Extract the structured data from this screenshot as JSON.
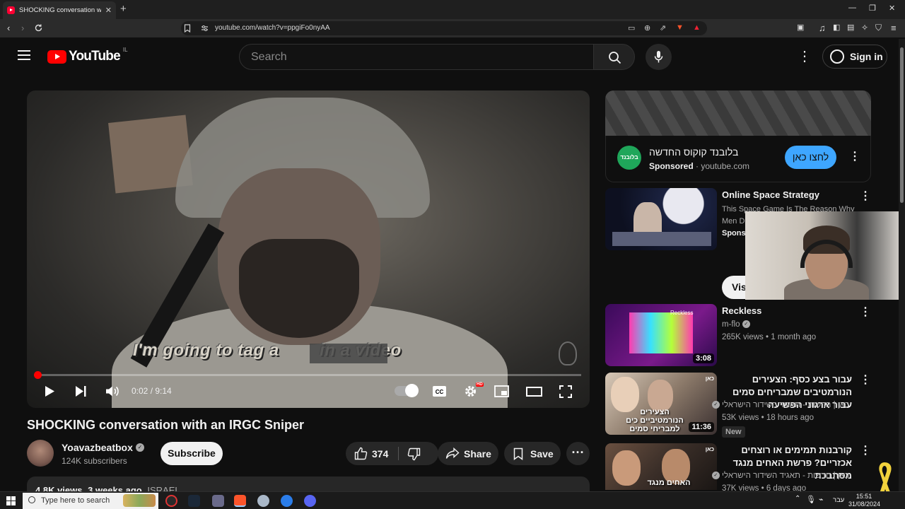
{
  "browser": {
    "tab_title": "SHOCKING conversation with an IRGC Sniper",
    "tab_close": "✕",
    "new_tab": "+",
    "url": "youtube.com/watch?v=ppgiFo0nyAA",
    "window_controls": [
      "—",
      "❐",
      "✕"
    ]
  },
  "header": {
    "logo_text": "YouTube",
    "country_code": "IL",
    "search_placeholder": "Search",
    "sign_in": "Sign in"
  },
  "player": {
    "caption_text": "I'm going to tag a        in a video",
    "current_time": "0:02",
    "duration": "9:14",
    "time_display": "0:02 / 9:14",
    "progress_fraction": 0.004,
    "hd_badge": "HD",
    "cc_label": "CC"
  },
  "video": {
    "title": "SHOCKING conversation with an IRGC Sniper",
    "channel": "Yoavazbeatbox",
    "subscribers": "124K subscribers",
    "subscribe": "Subscribe",
    "likes": "374",
    "share": "Share",
    "save": "Save",
    "description_views": "4.8K views",
    "description_date": "3 weeks ago",
    "description_tag": "ISRAEL"
  },
  "ad": {
    "title": "בלובנד קוקוס החדשה",
    "sponsored": "Sponsored",
    "domain": "youtube.com",
    "cta": "לחצו כאן",
    "logo_text": "בלובנד"
  },
  "related": [
    {
      "title": "Online Space Strategy",
      "line1": "This Space Game Is The Reason Why",
      "line2": "Men D",
      "sponsored": "Sponso",
      "button": "Vis"
    },
    {
      "title": "Reckless",
      "channel": "m-flo",
      "meta": "265K views • 1 month ago",
      "duration": "3:08",
      "thumb_text": "Reckless"
    },
    {
      "title": "עבור בצע כסף: הצעירים הנורמטיבים שמבריחים סמים עבור ארגוני הפשיעה",
      "channel": "כאן | חדשות - תאגיד השידור הישראלי",
      "meta": "53K views • 18 hours ago",
      "badge": "New",
      "duration": "11:36",
      "thumb_text": "הצעירים הנורמטיביים כים למבריחי סמים"
    },
    {
      "title": "קורבנות תמימים או רוצחים אכזריים? פרשת האחים מנגד מסתבכת",
      "channel": "כאן | חדשות - תאגיד השידור הישראלי",
      "meta": "37K views • 6 days ago",
      "thumb_text": "האחים מנגד"
    }
  ],
  "taskbar": {
    "search_placeholder": "Type here to search",
    "language": "עבר",
    "time": "15:51",
    "date": "31/08/2024"
  },
  "colors": {
    "background": "#0f0f0f",
    "accent_red": "#ff0000",
    "cta_blue": "#3ea6ff",
    "ad_green": "#1fa65a",
    "ribbon_yellow": "#f2d23c"
  }
}
